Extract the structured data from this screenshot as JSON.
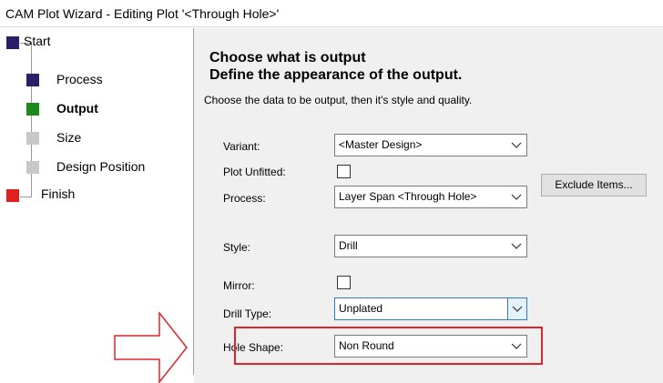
{
  "window": {
    "title": "CAM Plot Wizard - Editing Plot '<Through Hole>'"
  },
  "steps": [
    {
      "label": "Start",
      "color": "#2a2068",
      "bold": false
    },
    {
      "label": "Process",
      "color": "#2a2068",
      "bold": false
    },
    {
      "label": "Output",
      "color": "#1a8a1a",
      "bold": true
    },
    {
      "label": "Size",
      "color": "#c8c8c8",
      "bold": false
    },
    {
      "label": "Design Position",
      "color": "#c8c8c8",
      "bold": false
    },
    {
      "label": "Finish",
      "color": "#e02020",
      "bold": false
    }
  ],
  "main": {
    "heading1": "Choose what is output",
    "heading2": "Define the appearance of the output.",
    "description": "Choose the data to be output, then it's style and quality."
  },
  "fields": {
    "variant": {
      "label": "Variant:",
      "value": "<Master Design>"
    },
    "plot_unfitted": {
      "label": "Plot Unfitted:",
      "checked": false
    },
    "process": {
      "label": "Process:",
      "value": "Layer Span <Through Hole>"
    },
    "exclude_button": "Exclude Items...",
    "style": {
      "label": "Style:",
      "value": "Drill"
    },
    "mirror": {
      "label": "Mirror:",
      "checked": false
    },
    "drill_type": {
      "label": "Drill Type:",
      "value": "Unplated"
    },
    "hole_shape": {
      "label": "Hole Shape:",
      "value": "Non Round"
    }
  },
  "annotation": {
    "highlight_color": "#e0242a",
    "arrow": "arrow-right-icon"
  }
}
